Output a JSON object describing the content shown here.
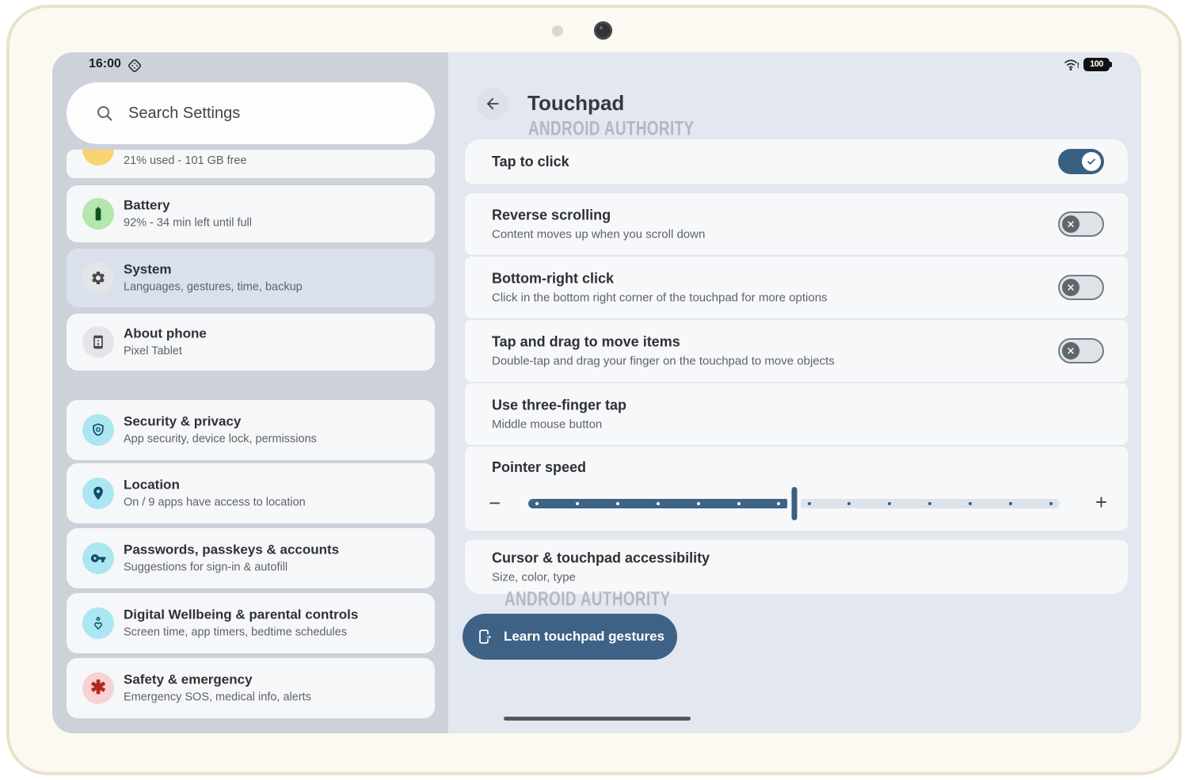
{
  "status_bar": {
    "time": "16:00",
    "battery_percent": "100",
    "icons": [
      "hub-mode-icon",
      "wifi-alert-icon",
      "battery-100-icon"
    ]
  },
  "sidebar": {
    "search_placeholder": "Search Settings",
    "partial_item": {
      "subtitle": "21% used - 101 GB free",
      "icon": "storage-icon"
    },
    "items": [
      {
        "title": "Battery",
        "subtitle": "92% - 34 min left until full",
        "icon": "battery-icon",
        "selected": false
      },
      {
        "title": "System",
        "subtitle": "Languages, gestures, time, backup",
        "icon": "gear-icon",
        "selected": true
      },
      {
        "title": "About phone",
        "subtitle": "Pixel Tablet",
        "icon": "phone-icon",
        "selected": false
      },
      {
        "title": "Security & privacy",
        "subtitle": "App security, device lock, permissions",
        "icon": "shield-icon",
        "selected": false
      },
      {
        "title": "Location",
        "subtitle": "On / 9 apps have access to location",
        "icon": "location-pin-icon",
        "selected": false
      },
      {
        "title": "Passwords, passkeys & accounts",
        "subtitle": "Suggestions for sign-in & autofill",
        "icon": "key-icon",
        "selected": false
      },
      {
        "title": "Digital Wellbeing & parental controls",
        "subtitle": "Screen time, app timers, bedtime schedules",
        "icon": "wellbeing-icon",
        "selected": false
      },
      {
        "title": "Safety & emergency",
        "subtitle": "Emergency SOS, medical info, alerts",
        "icon": "asterisk-icon",
        "selected": false
      }
    ]
  },
  "main": {
    "title": "Touchpad",
    "watermark": "ANDROID AUTHORITY",
    "rows": [
      {
        "title": "Tap to click",
        "toggle": "on"
      },
      {
        "title": "Reverse scrolling",
        "subtitle": "Content moves up when you scroll down",
        "toggle": "off"
      },
      {
        "title": "Bottom-right click",
        "subtitle": "Click in the bottom right corner of the touchpad for more options",
        "toggle": "off"
      },
      {
        "title": "Tap and drag to move items",
        "subtitle": "Double-tap and drag your finger on the touchpad to move objects",
        "toggle": "off"
      },
      {
        "title": "Use three-finger tap",
        "subtitle": "Middle mouse button"
      },
      {
        "title": "Pointer speed",
        "slider": {
          "value_pct": 50,
          "minus_label": "−",
          "plus_label": "+"
        }
      },
      {
        "title": "Cursor & touchpad accessibility",
        "subtitle": "Size, color, type"
      }
    ],
    "button": {
      "label": "Learn touchpad gestures",
      "icon": "tablet-gesture-icon"
    }
  },
  "colors": {
    "bezel": "#fbf9f2",
    "bezel_border": "#e9e2cb",
    "sidebar_bg": "#cdd2da",
    "main_bg": "#e2e7f0",
    "card_bg": "#f7f8fa",
    "selected_bg": "#dbe1ec",
    "accent_blue": "#39607f",
    "button_blue": "#3d6285",
    "icon_cyan_bg": "#abe6f2",
    "icon_cyan_glyph": "#0e4f5e",
    "icon_green_bg": "#b4e6ae",
    "icon_green_glyph": "#0b5223",
    "icon_gray_bg": "#e3e5e8",
    "icon_yellow_bg": "#f8d470",
    "icon_pink_bg": "#f7d1d4",
    "icon_red_glyph": "#b3261e"
  }
}
